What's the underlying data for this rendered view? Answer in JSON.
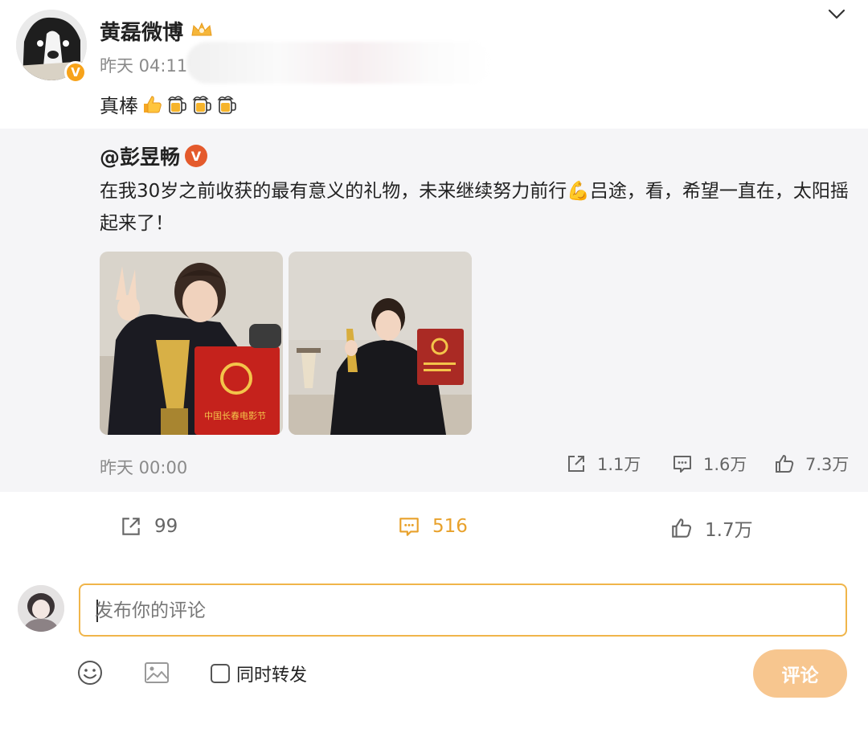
{
  "post": {
    "author": "黄磊微博",
    "time": "昨天 04:11",
    "text": "真棒"
  },
  "repost": {
    "author": "@彭昱畅",
    "text": "在我30岁之前收获的最有意义的礼物，未来继续努力前行💪吕途，看，希望一直在，太阳摇起来了！",
    "time": "昨天 00:00",
    "stats": {
      "reposts": "1.1万",
      "comments": "1.6万",
      "likes": "7.3万"
    },
    "photos": [
      {
        "caption": "中国长春电影节"
      },
      {
        "caption": ""
      }
    ]
  },
  "actions": {
    "reposts": "99",
    "comments": "516",
    "likes": "1.7万"
  },
  "compose": {
    "placeholder": "发布你的评论",
    "repost_label": "同时转发",
    "submit_label": "评论"
  },
  "colors": {
    "accent": "#e8a12b",
    "input_border": "#f0b54a",
    "submit_bg": "#f7c68f",
    "repost_bg": "#f5f5f7",
    "verified_orange": "#f7a31a"
  }
}
